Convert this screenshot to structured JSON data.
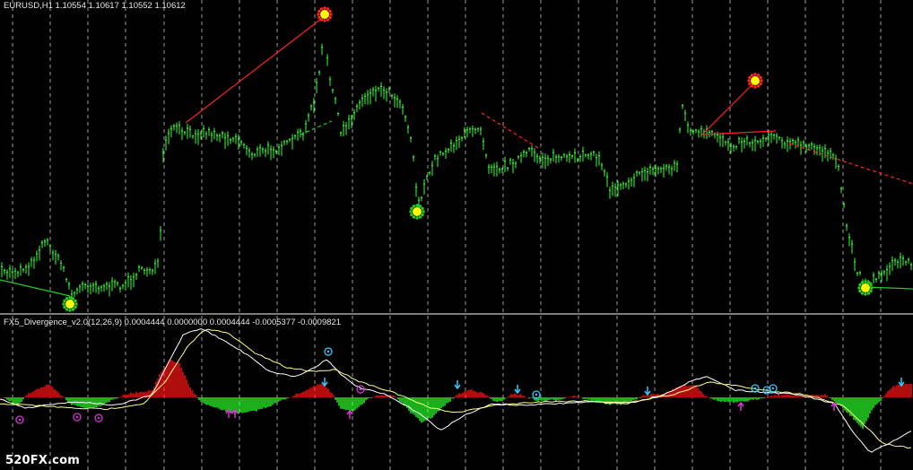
{
  "app": {
    "symbol_header": "EURUSD,H1  1.10554 1.10617 1.10552 1.10612",
    "indicator_header": "FX5_Divergence_v2.0(12,26,9) 0.0004444 0.0000000 0.0004444 -0.0005377 -0.0009821",
    "watermark": "520FX.com"
  },
  "colors": {
    "background": "#000000",
    "candles": "#33ff33",
    "bull_histogram": "#dd1111",
    "bear_histogram": "#22dd22",
    "macd_line": "#ffffff",
    "signal_line": "#ffff88",
    "divergence_line": "#ff2222",
    "bull_divergence_line": "#22cc22",
    "top_marker": "#ff2222",
    "bottom_marker": "#22cc22",
    "marker_core": "#ffff00",
    "arrow_down": "#33ccff",
    "arrow_up": "#dd33dd",
    "grid": "#cfcfcf"
  },
  "icons": {
    "top_marker": "sun-top-icon",
    "bottom_marker": "sun-bottom-icon",
    "arrow_down": "cyan-down-arrow-icon",
    "arrow_up": "magenta-up-arrow-icon",
    "circle_top": "cyan-circle-icon",
    "circle_bottom": "magenta-circle-icon"
  }
}
